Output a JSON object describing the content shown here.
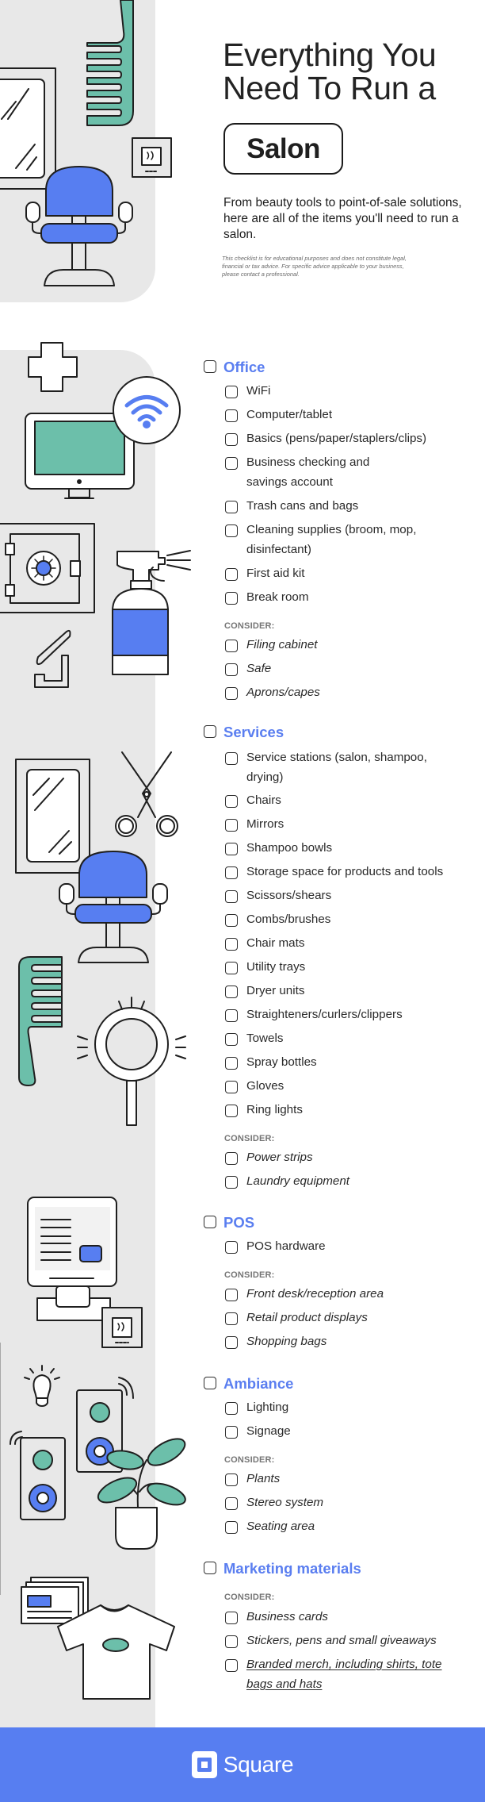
{
  "header": {
    "title_line1": "Everything You",
    "title_line2": "Need To Run a",
    "badge": "Salon",
    "intro": "From beauty tools to point-of-sale solutions, here are all of the items you'll need to run a salon.",
    "disclaimer": "This checklist is for educational purposes and does not constitute legal, financial or tax advice. For specific advice applicable to your business, please contact a professional."
  },
  "consider_label": "CONSIDER:",
  "sections": {
    "office": {
      "heading": "Office",
      "items": [
        "WiFi",
        "Computer/tablet",
        "Basics (pens/paper/staplers/clips)",
        "Business checking and savings account",
        "Trash cans and bags",
        "Cleaning supplies (broom, mop, disinfectant)",
        "First aid kit",
        "Break room"
      ],
      "consider": [
        "Filing cabinet",
        "Safe",
        "Aprons/capes"
      ]
    },
    "services": {
      "heading": "Services",
      "items": [
        "Service stations (salon, shampoo, drying)",
        "Chairs",
        "Mirrors",
        "Shampoo bowls",
        "Storage space for products and tools",
        "Scissors/shears",
        "Combs/brushes",
        "Chair mats",
        "Utility trays",
        "Dryer units",
        "Straighteners/curlers/clippers",
        "Towels",
        "Spray bottles",
        "Gloves",
        "Ring lights"
      ],
      "consider": [
        "Power strips",
        "Laundry equipment"
      ]
    },
    "pos": {
      "heading": "POS",
      "items": [
        "POS hardware"
      ],
      "consider": [
        "Front desk/reception area",
        "Retail product displays",
        "Shopping bags"
      ]
    },
    "ambiance": {
      "heading": "Ambiance",
      "items": [
        "Lighting",
        "Signage"
      ],
      "consider": [
        "Plants",
        "Stereo system",
        "Seating area"
      ]
    },
    "marketing": {
      "heading": "Marketing materials",
      "items": [],
      "consider": [
        "Business cards",
        "Stickers, pens and small giveaways",
        "Branded merch, including shirts, tote bags and hats"
      ]
    }
  },
  "footer": {
    "brand": "Square"
  },
  "colors": {
    "accent": "#577ef1",
    "heading_blue": "#5a7ef0",
    "teal": "#6cbfaa",
    "panel_gray": "#e8e8e8"
  },
  "illustrations": [
    "comb-icon",
    "mirror-icon",
    "salon-chair-icon",
    "card-reader-icon",
    "first-aid-cross-icon",
    "monitor-icon",
    "wifi-icon",
    "safe-icon",
    "spray-bottle-icon",
    "stapler-icon",
    "scissors-icon",
    "ring-light-icon",
    "pos-terminal-icon",
    "light-bulb-icon",
    "speaker-icon",
    "plant-icon",
    "business-cards-icon",
    "t-shirt-icon"
  ]
}
